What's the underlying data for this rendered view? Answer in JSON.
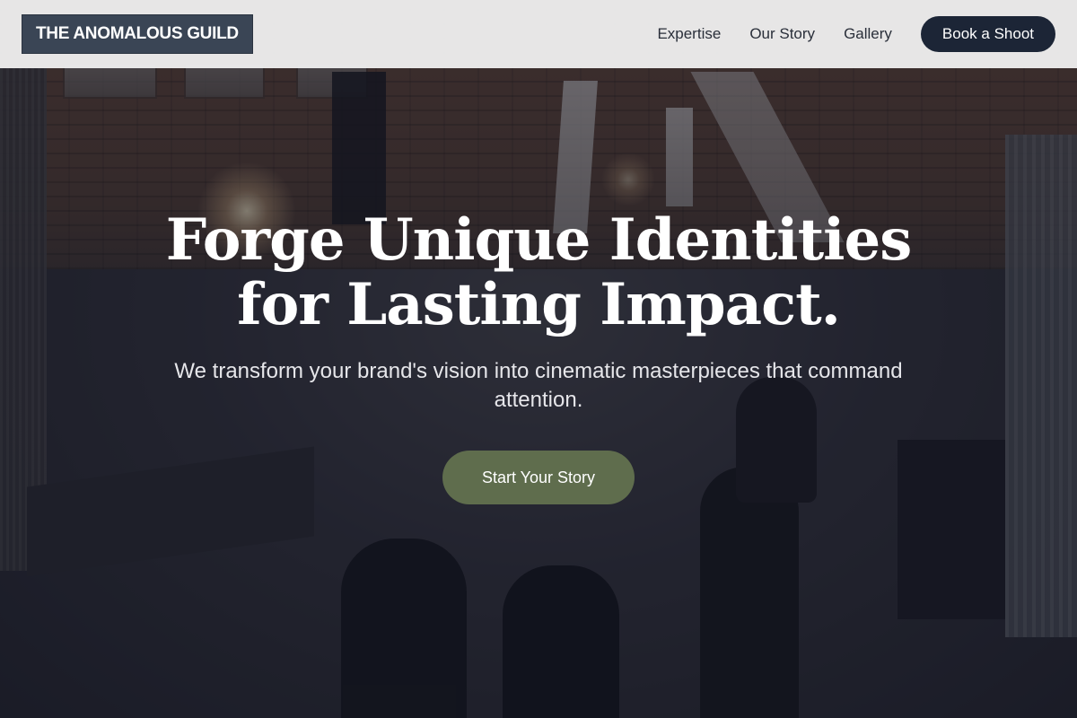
{
  "brand": {
    "logo_text": "THE ANOMALOUS GUILD"
  },
  "nav": {
    "links": [
      {
        "label": "Expertise"
      },
      {
        "label": "Our Story"
      },
      {
        "label": "Gallery"
      }
    ],
    "cta_label": "Book a Shoot"
  },
  "hero": {
    "title_line_1": "Forge Unique Identities",
    "title_line_2": "for Lasting Impact.",
    "subtitle": "We transform your brand's vision into cinematic masterpieces that command attention.",
    "cta_label": "Start Your Story",
    "background_description_icon": "film-set-photo"
  },
  "colors": {
    "header_bg": "#eeeeee",
    "logo_bg": "#3a4555",
    "nav_text": "#2a2f3a",
    "book_button_bg": "#1c2536",
    "cta_bg": "#5f6d4d",
    "hero_text": "#ffffff"
  }
}
